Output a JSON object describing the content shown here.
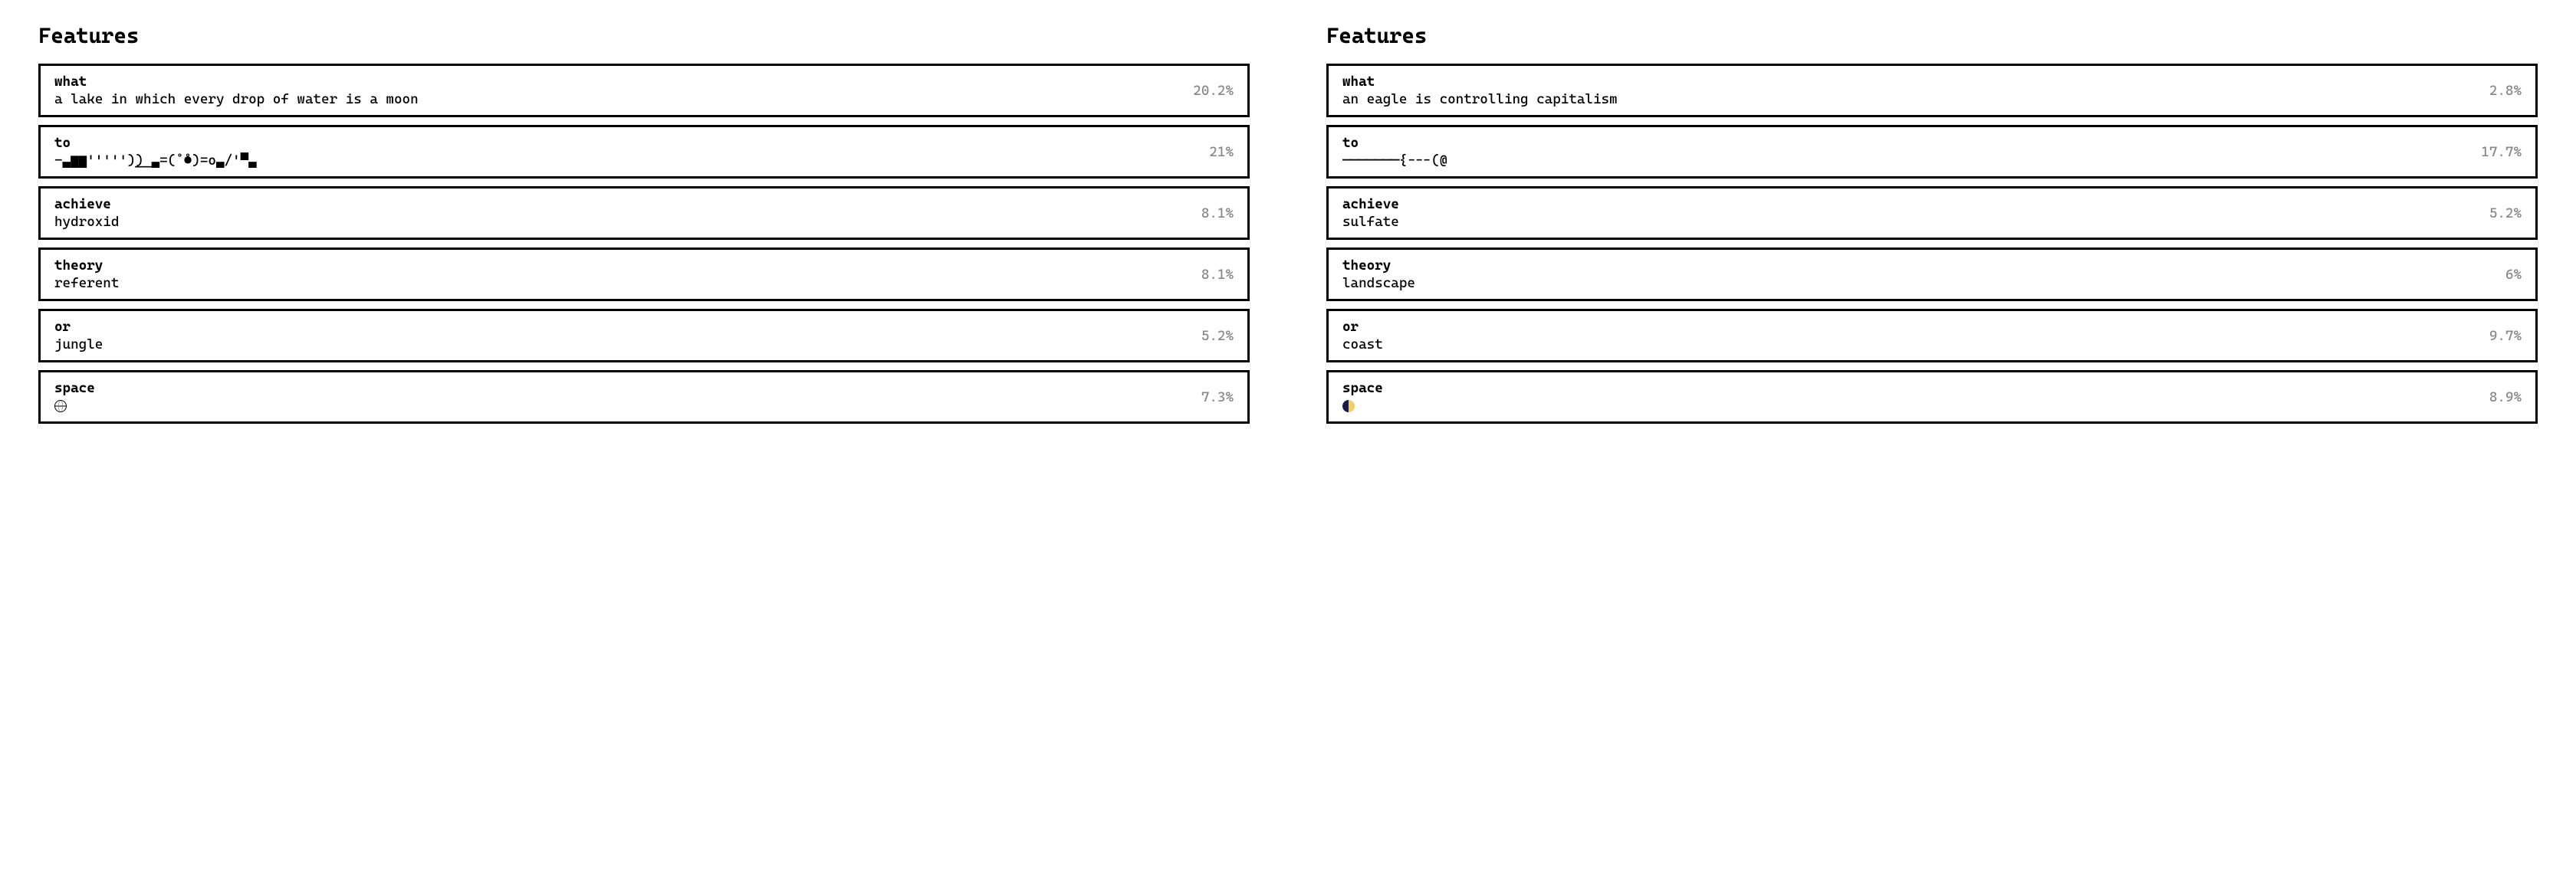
{
  "columns": [
    {
      "title": "Features",
      "items": [
        {
          "label": "what",
          "value": "a lake in which every drop of water is a moon",
          "percent": "20.2%",
          "icon": null
        },
        {
          "label": "to",
          "value": "-▃▆▆''''')̲)̲ ▃=(˚̊●)=o▃/'▀▃",
          "percent": "21%",
          "icon": null
        },
        {
          "label": "achieve",
          "value": "hydroxid",
          "percent": "8.1%",
          "icon": null
        },
        {
          "label": "theory",
          "value": "referent",
          "percent": "8.1%",
          "icon": null
        },
        {
          "label": "or",
          "value": "jungle",
          "percent": "5.2%",
          "icon": null
        },
        {
          "label": "space",
          "value": "",
          "percent": "7.3%",
          "icon": "globe"
        }
      ]
    },
    {
      "title": "Features",
      "items": [
        {
          "label": "what",
          "value": "an eagle is controlling capitalism",
          "percent": "2.8%",
          "icon": null
        },
        {
          "label": "to",
          "value": "───────{---(@",
          "percent": "17.7%",
          "icon": null
        },
        {
          "label": "achieve",
          "value": "sulfate",
          "percent": "5.2%",
          "icon": null
        },
        {
          "label": "theory",
          "value": "landscape",
          "percent": "6%",
          "icon": null
        },
        {
          "label": "or",
          "value": "coast",
          "percent": "9.7%",
          "icon": null
        },
        {
          "label": "space",
          "value": "",
          "percent": "8.9%",
          "icon": "halfmoon"
        }
      ]
    }
  ]
}
